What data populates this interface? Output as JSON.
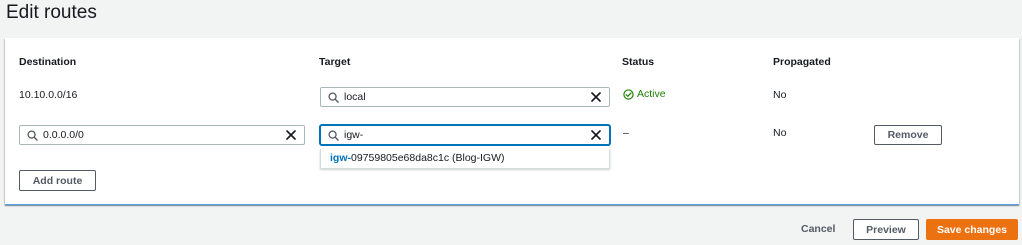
{
  "page": {
    "title": "Edit routes"
  },
  "table": {
    "columns": {
      "destination": "Destination",
      "target": "Target",
      "status": "Status",
      "propagated": "Propagated"
    },
    "rows": [
      {
        "destination": "10.10.0.0/16",
        "target_value": "local",
        "status": "Active",
        "propagated": "No"
      },
      {
        "destination_value": "0.0.0.0/0",
        "target_value": "igw-",
        "status": "–",
        "propagated": "No",
        "remove_label": "Remove"
      }
    ],
    "suggestion": {
      "match": "igw-",
      "rest": "09759805e68da8c1c (Blog-IGW)"
    },
    "add_route_label": "Add route"
  },
  "footer": {
    "cancel_label": "Cancel",
    "preview_label": "Preview",
    "save_label": "Save changes"
  },
  "colors": {
    "primary": "#ec7211",
    "active_status": "#1d8102",
    "focus": "#0073bb"
  },
  "icons": [
    "search-icon",
    "clear-icon",
    "status-active-icon"
  ]
}
